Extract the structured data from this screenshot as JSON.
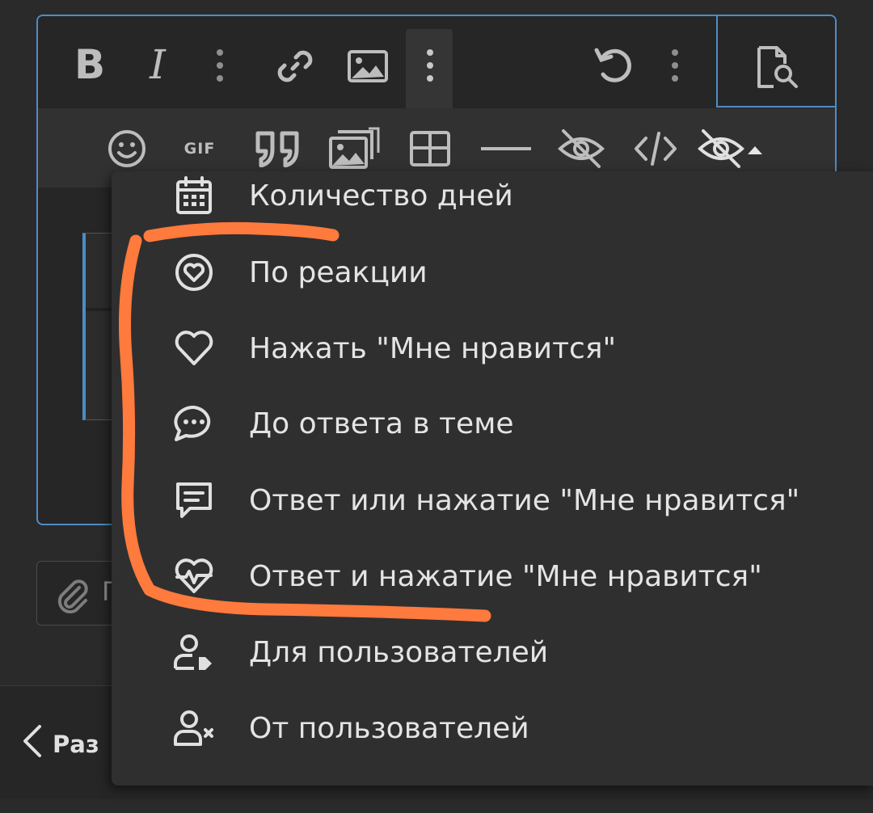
{
  "toolbar": {
    "row1": [
      {
        "name": "bold-icon",
        "glyph": "B"
      },
      {
        "name": "italic-icon",
        "glyph": "I"
      }
    ]
  },
  "attach": {
    "label": "П"
  },
  "navigation": {
    "back_label": "Раз"
  },
  "menu": {
    "items": [
      {
        "label": "Количество дней",
        "icon": "calendar-icon"
      },
      {
        "label": "По реакции",
        "icon": "reaction-heart-icon"
      },
      {
        "label": "Нажать \"Мне нравится\"",
        "icon": "heart-icon"
      },
      {
        "label": "До ответа в теме",
        "icon": "chat-bubble-icon"
      },
      {
        "label": "Ответ или нажатие \"Мне нравится\"",
        "icon": "message-icon"
      },
      {
        "label": "Ответ и нажатие \"Мне нравится\"",
        "icon": "heart-pulse-icon"
      },
      {
        "label": "Для пользователей",
        "icon": "user-tag-icon"
      },
      {
        "label": "От пользователей",
        "icon": "user-remove-icon"
      }
    ]
  },
  "colors": {
    "background": "#2a2a2b",
    "editor_border": "#4f8cc4",
    "dropdown_bg": "#2f2f30",
    "annotation_stroke": "#ff7a3d"
  }
}
